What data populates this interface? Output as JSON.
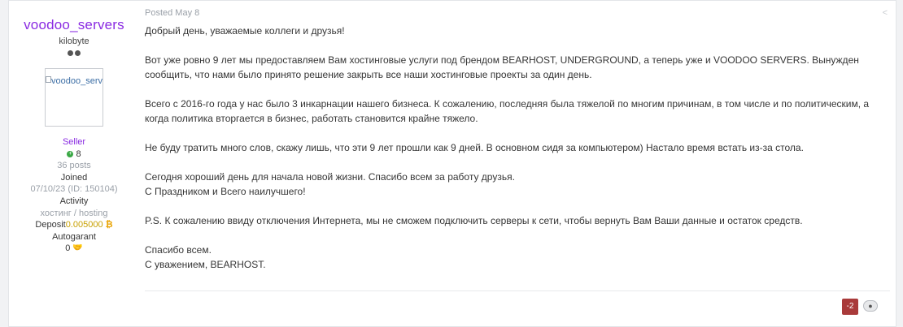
{
  "author": {
    "username": "voodoo_servers",
    "rank": "kilobyte",
    "avatar_alt": "voodoo_servers",
    "group": "Seller",
    "reputation": "8",
    "posts": "36 posts",
    "joined_label": "Joined",
    "joined_value": "07/10/23 (ID: 150104)",
    "activity_label": "Activity",
    "activity_value": "хостинг / hosting",
    "deposit_label": "Deposit",
    "deposit_value": "0.005000",
    "deposit_currency_icon": "bitcoin-icon",
    "autogarant_label": "Autogarant",
    "autogarant_value": "0"
  },
  "post": {
    "posted": "Posted May 8",
    "paragraphs": [
      "Добрый день, уважаемые коллеги и друзья!",
      "Вот уже ровно 9 лет мы предоставляем Вам хостинговые услуги под брендом BEARHOST, UNDERGROUND, а теперь уже и VOODOO SERVERS. Вынужден сообщить, что нами было принято решение закрыть все наши хостинговые проекты за один день.",
      "Всего с 2016-го года у нас было 3 инкарнации нашего бизнеса. К сожалению, последняя была тяжелой по многим причинам, в том числе и по политическим, а когда политика вторгается в бизнес, работать становится крайне тяжело.",
      "Не буду тратить много слов, скажу лишь, что эти 9 лет прошли как 9 дней. В основном сидя за компьютером) Настало время встать из-за стола.",
      "Сегодня хороший день для начала новой жизни. Спасибо всем за работу друзья.\nС Праздником и Всего наилучшего!",
      "P.S. К сожалению ввиду отключения Интернета, мы не сможем подключить серверы к сети, чтобы вернуть Вам Ваши данные и остаток средств.",
      "Спасибо всем.\nС уважением, BEARHOST."
    ],
    "reputation_count": "-2"
  },
  "colors": {
    "username": "#8a2be2",
    "reputation_negative": "#a93a3a",
    "deposit_value": "#c8a000"
  }
}
